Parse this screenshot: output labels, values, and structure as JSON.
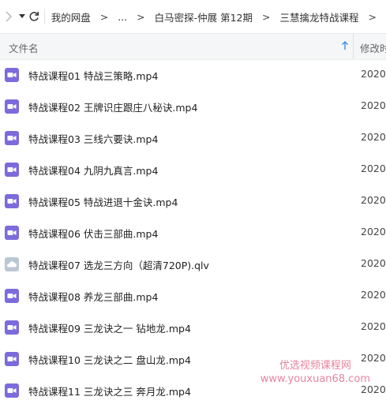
{
  "nav": {
    "breadcrumbs": [
      "我的网盘",
      "...",
      "白马密探-仲展 第12期",
      "三慧擒龙特战课程"
    ],
    "separator": ">"
  },
  "columns": {
    "name": "文件名",
    "modified": "修改时"
  },
  "files": [
    {
      "name": "特战课程01 特战三策略.mp4",
      "date": "2020-",
      "icon": "video-file-icon"
    },
    {
      "name": "特战课程02 王牌识庄跟庄八秘诀.mp4",
      "date": "2020-",
      "icon": "video-file-icon"
    },
    {
      "name": "特战课程03 三线六要诀.mp4",
      "date": "2020-",
      "icon": "video-file-icon"
    },
    {
      "name": "特战课程04 九阴九真言.mp4",
      "date": "2020-",
      "icon": "video-file-icon"
    },
    {
      "name": "特战课程05 特战进退十金诀.mp4",
      "date": "2020-",
      "icon": "video-file-icon"
    },
    {
      "name": "特战课程06 伏击三部曲.mp4",
      "date": "2020-",
      "icon": "video-file-icon"
    },
    {
      "name": "特战课程07 选龙三方向（超清720P).qlv",
      "date": "2020-",
      "icon": "cloud-file-icon"
    },
    {
      "name": "特战课程08 养龙三部曲.mp4",
      "date": "2020-",
      "icon": "video-file-icon"
    },
    {
      "name": "特战课程09 三龙诀之一 钻地龙.mp4",
      "date": "2020-",
      "icon": "video-file-icon"
    },
    {
      "name": "特战课程10 三龙诀之二 盘山龙.mp4",
      "date": "2020-",
      "icon": "video-file-icon"
    },
    {
      "name": "特战课程11 三龙诀之三 奔月龙.mp4",
      "date": "2020-",
      "icon": "video-file-icon"
    }
  ],
  "watermark": {
    "line1": "优选视频课程网",
    "line2": "www.youxuan68.com"
  },
  "colors": {
    "video_icon": "#7b6bdc",
    "cloud_icon": "#bcc7d6",
    "sort_arrow": "#3b8fe0"
  }
}
